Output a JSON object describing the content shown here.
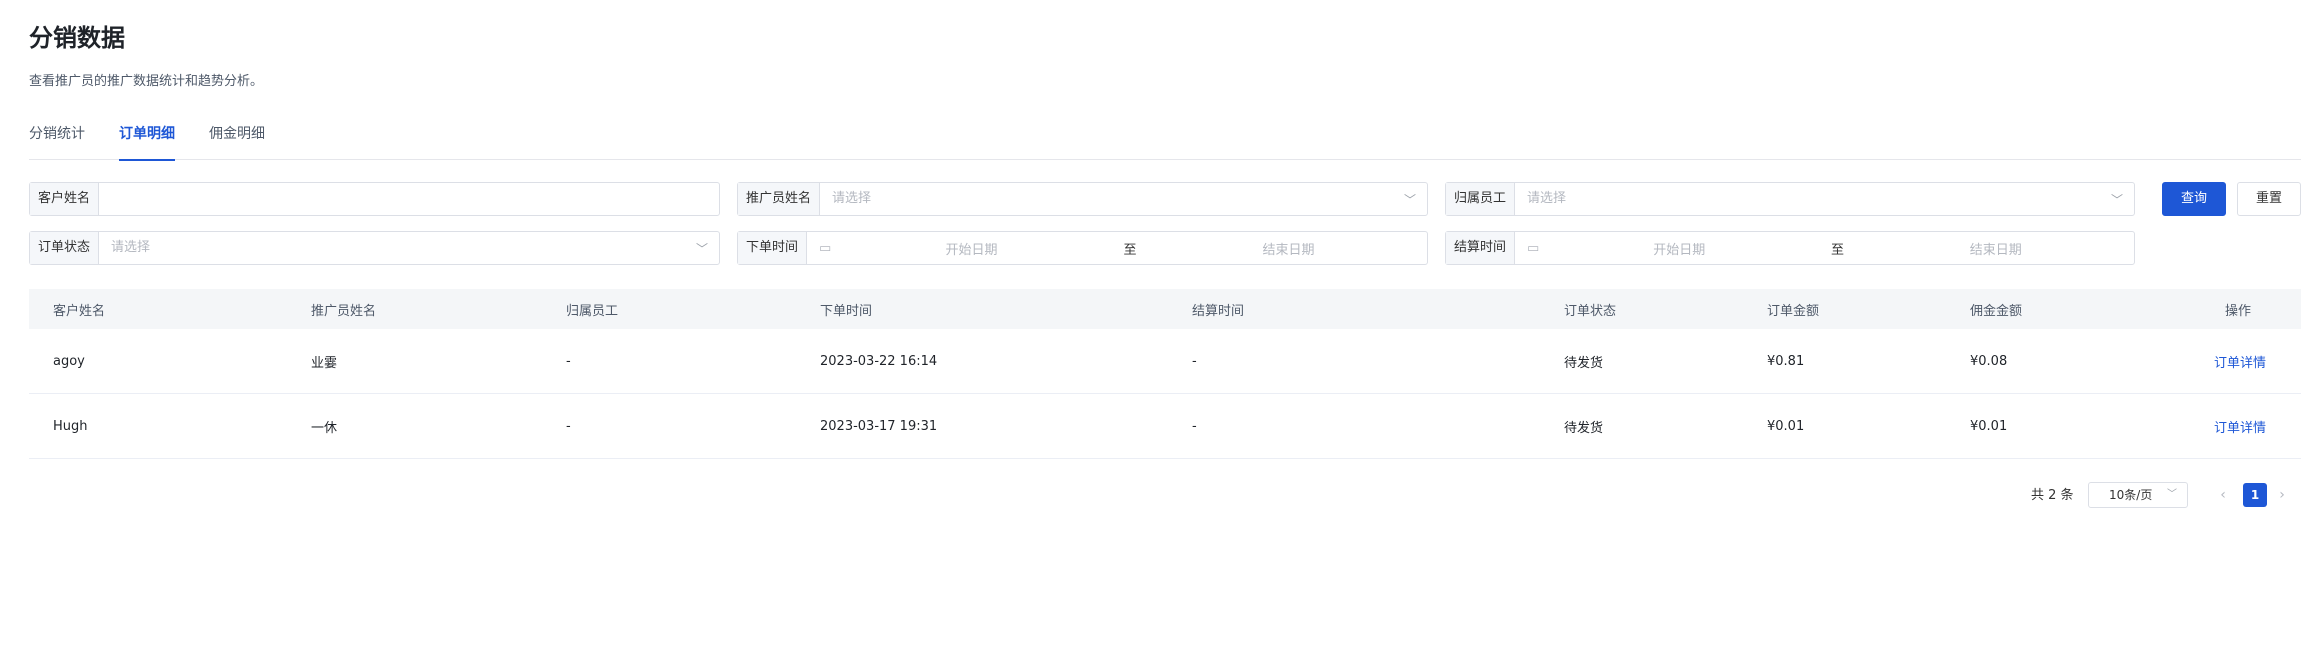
{
  "page": {
    "title": "分销数据",
    "description": "查看推广员的推广数据统计和趋势分析。"
  },
  "tabs": [
    {
      "label": "分销统计",
      "active": false
    },
    {
      "label": "订单明细",
      "active": true
    },
    {
      "label": "佣金明细",
      "active": false
    }
  ],
  "filters": {
    "customer_name": {
      "label": "客户姓名",
      "value": "",
      "placeholder": ""
    },
    "promoter_name": {
      "label": "推广员姓名",
      "placeholder": "请选择"
    },
    "employee": {
      "label": "归属员工",
      "placeholder": "请选择"
    },
    "order_status": {
      "label": "订单状态",
      "placeholder": "请选择"
    },
    "order_time": {
      "label": "下单时间",
      "start_placeholder": "开始日期",
      "separator": "至",
      "end_placeholder": "结束日期"
    },
    "settle_time": {
      "label": "结算时间",
      "start_placeholder": "开始日期",
      "separator": "至",
      "end_placeholder": "结束日期"
    },
    "query_label": "查询",
    "reset_label": "重置"
  },
  "table": {
    "columns": [
      "客户姓名",
      "推广员姓名",
      "归属员工",
      "下单时间",
      "结算时间",
      "订单状态",
      "订单金额",
      "佣金金额",
      "操作"
    ],
    "rows": [
      {
        "customer": "agoy",
        "promoter": "业霎",
        "employee": "-",
        "order_time": "2023-03-22 16:14",
        "settle_time": "-",
        "status": "待发货",
        "amount": "¥0.81",
        "commission": "¥0.08",
        "action": "订单详情"
      },
      {
        "customer": "Hugh",
        "promoter": "一休",
        "employee": "-",
        "order_time": "2023-03-17 19:31",
        "settle_time": "-",
        "status": "待发货",
        "amount": "¥0.01",
        "commission": "¥0.01",
        "action": "订单详情"
      }
    ]
  },
  "pagination": {
    "total": "共 2 条",
    "page_size": "10条/页",
    "current_page": "1",
    "prev_icon": "chevron-left-icon",
    "next_icon": "chevron-right-icon"
  },
  "colors": {
    "accent": "#1e57d6",
    "header_bg": "#f4f6f8",
    "border": "#dcdfe6"
  }
}
